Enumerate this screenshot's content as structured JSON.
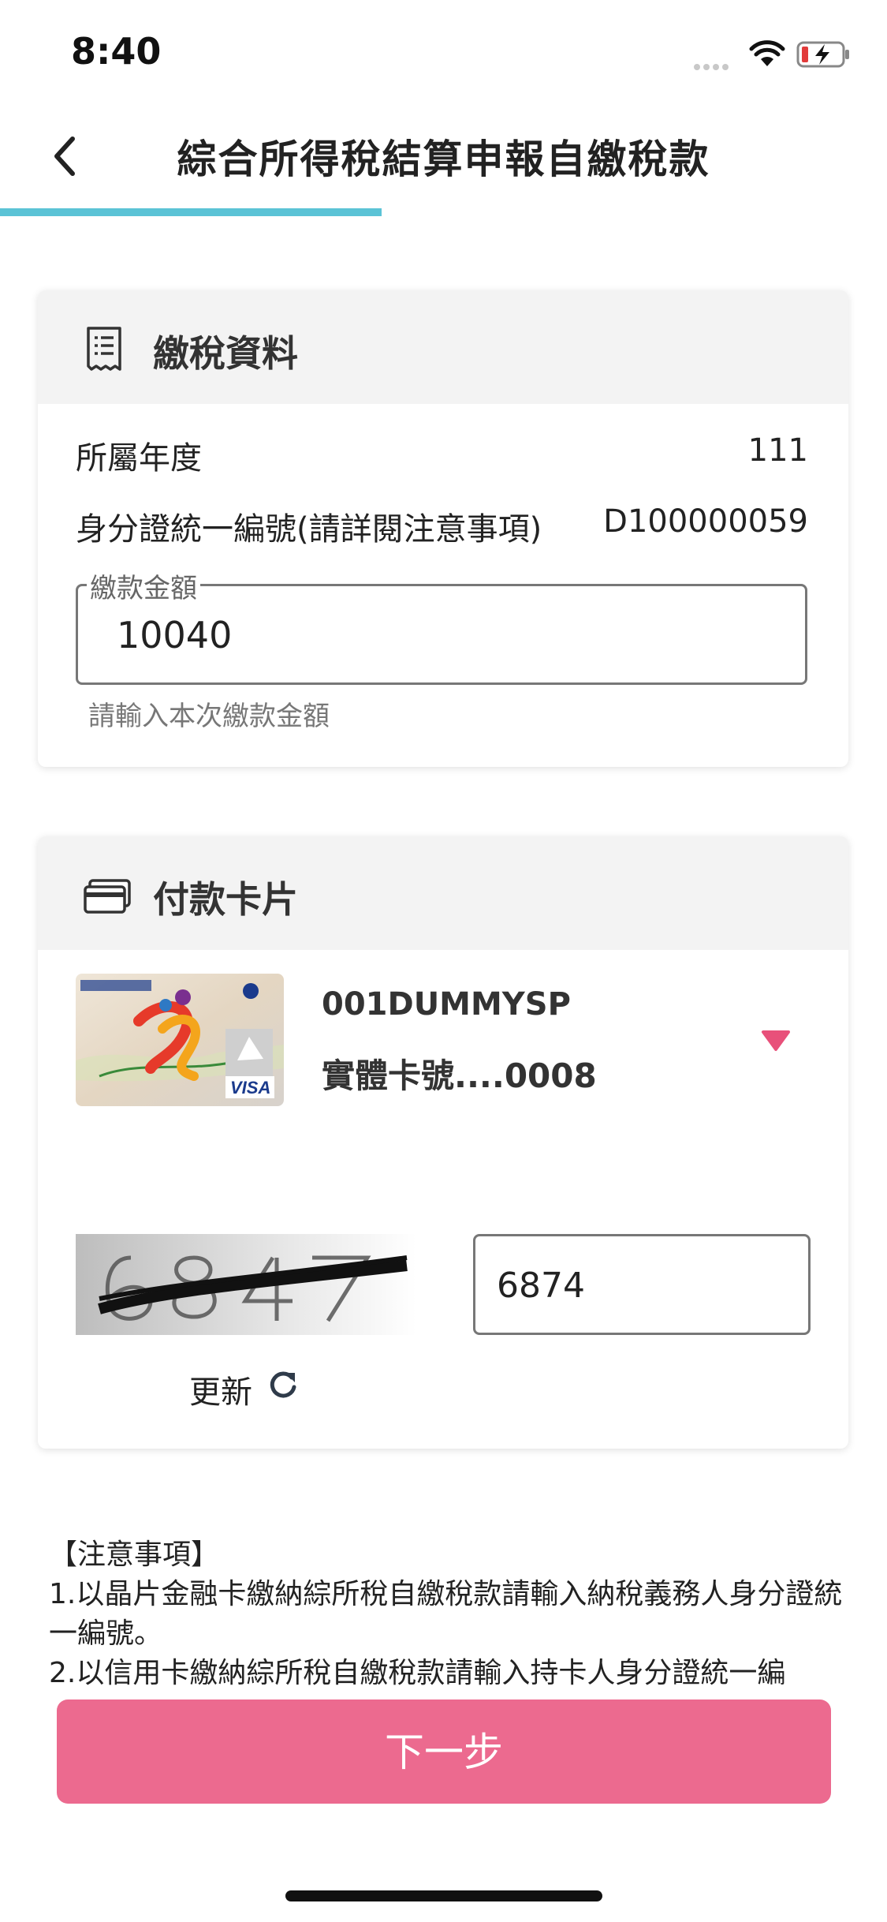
{
  "status_bar": {
    "time": "8:40"
  },
  "header": {
    "title": "綜合所得稅結算申報自繳稅款",
    "progress": 0.43
  },
  "tax_info": {
    "title": "繳稅資料",
    "year_label": "所屬年度",
    "year_value": "111",
    "id_label": "身分證統一編號(請詳閱注意事項)",
    "id_value": "D100000059",
    "amount_label": "繳款金額",
    "amount_value": "10040",
    "amount_hint": "請輸入本次繳款金額"
  },
  "payment_card": {
    "title": "付款卡片",
    "card_name": "001DUMMYSP",
    "card_number": "實體卡號....0008",
    "captcha_input_value": "6874",
    "refresh_label": "更新"
  },
  "notice": {
    "heading": "【注意事項】",
    "line1": "1.以晶片金融卡繳納綜所稅自繳稅款請輸入納稅義務人身分證統一編號。",
    "line2": "2.以信用卡繳納綜所稅自繳稅款請輸入持卡人身分證統一編"
  },
  "footer": {
    "next_label": "下一步"
  },
  "colors": {
    "accent": "#5bc3d6",
    "primary_button": "#ec6a8f",
    "dropdown": "#e8507a"
  }
}
